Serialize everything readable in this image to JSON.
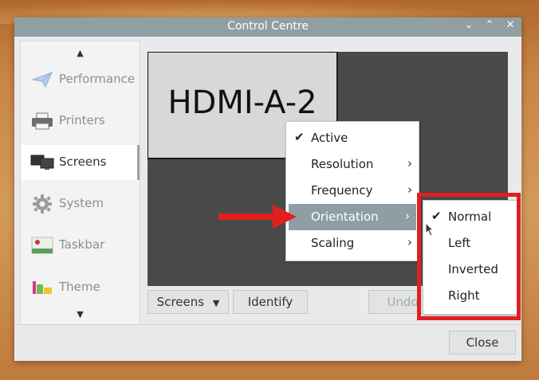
{
  "window": {
    "title": "Control Centre"
  },
  "titlebar_buttons": {
    "minimize": "⌄",
    "maximize": "⌃",
    "close": "✕"
  },
  "sidebar": {
    "up_arrow": "▲",
    "down_arrow": "▼",
    "items": [
      {
        "label": "Performance",
        "icon": "paper-plane-icon"
      },
      {
        "label": "Printers",
        "icon": "printer-icon"
      },
      {
        "label": "Screens",
        "icon": "monitors-icon",
        "selected": true
      },
      {
        "label": "System",
        "icon": "gear-icon"
      },
      {
        "label": "Taskbar",
        "icon": "taskbar-icon"
      },
      {
        "label": "Theme",
        "icon": "theme-icon"
      }
    ]
  },
  "screen_area": {
    "monitor_label": "HDMI-A-2"
  },
  "buttons": {
    "screens": "Screens",
    "identify": "Identify",
    "undo": "Undo",
    "close": "Close"
  },
  "context_menu": {
    "items": [
      {
        "label": "Active",
        "checked": true
      },
      {
        "label": "Resolution",
        "submenu": true
      },
      {
        "label": "Frequency",
        "submenu": true
      },
      {
        "label": "Orientation",
        "submenu": true,
        "highlighted": true
      },
      {
        "label": "Scaling",
        "submenu": true
      }
    ]
  },
  "orientation_submenu": {
    "items": [
      {
        "label": "Normal",
        "checked": true
      },
      {
        "label": "Left"
      },
      {
        "label": "Inverted"
      },
      {
        "label": "Right"
      }
    ]
  },
  "glyphs": {
    "check": "✔",
    "chevron": "›",
    "dropdown": "▼"
  },
  "colors": {
    "highlight": "#8e9ea4",
    "annotation_red": "#e02020",
    "titlebar": "#8f9fa4"
  }
}
